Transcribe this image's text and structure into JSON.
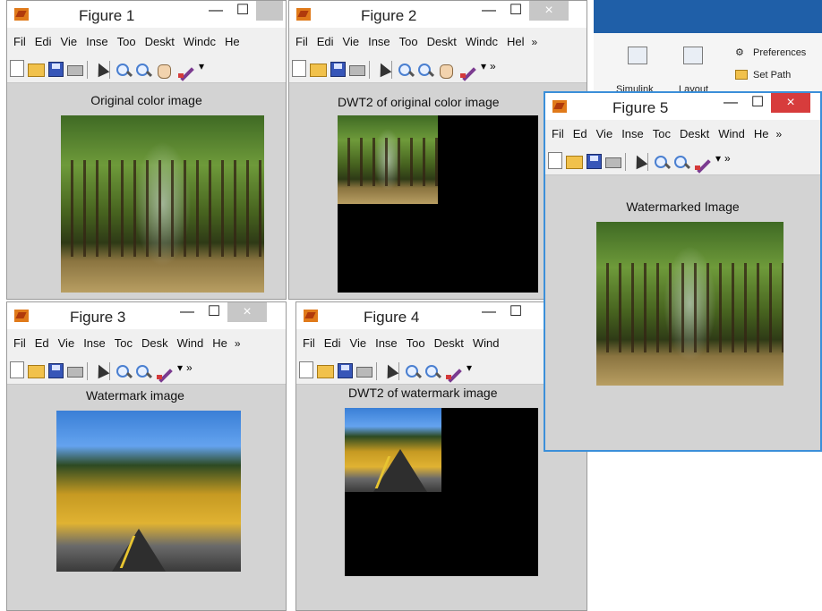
{
  "desktop": {
    "ribbon_buttons": [
      "Simulink",
      "Layout"
    ],
    "ribbon_links": [
      "Preferences",
      "Set Path"
    ]
  },
  "windows": [
    {
      "title": "Figure 1",
      "menus": [
        "Fil",
        "Edi",
        "Vie",
        "Inse",
        "Too",
        "Deskt",
        "Windc",
        "He"
      ],
      "axes_title": "Original color image"
    },
    {
      "title": "Figure 2",
      "menus": [
        "Fil",
        "Edi",
        "Vie",
        "Inse",
        "Too",
        "Deskt",
        "Windc",
        "Hel"
      ],
      "axes_title": "DWT2 of original color image"
    },
    {
      "title": "Figure 3",
      "menus": [
        "Fil",
        "Ed",
        "Vie",
        "Inse",
        "Toc",
        "Desk",
        "Wind",
        "He"
      ],
      "axes_title": "Watermark image"
    },
    {
      "title": "Figure 4",
      "menus": [
        "Fil",
        "Edi",
        "Vie",
        "Inse",
        "Too",
        "Deskt",
        "Wind"
      ],
      "axes_title": "DWT2 of watermark image"
    },
    {
      "title": "Figure 5",
      "menus": [
        "Fil",
        "Ed",
        "Vie",
        "Inse",
        "Toc",
        "Deskt",
        "Wind",
        "He"
      ],
      "axes_title": "Watermarked Image"
    }
  ],
  "colors": {
    "active_border": "#3b8fd9",
    "close_active": "#d73c3c",
    "figure_bg": "#d3d3d3"
  }
}
